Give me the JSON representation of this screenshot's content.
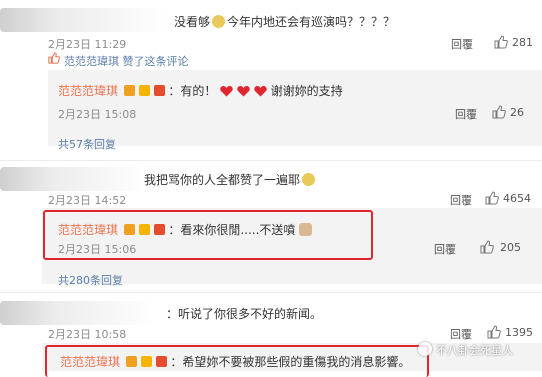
{
  "c1": {
    "text": "没看够",
    "text2": "今年内地还会有巡演吗？？？？",
    "date": "2月23日 11:29",
    "reply": "回覆",
    "likes": "281",
    "liked_by": "范范范瑋琪 赞了这条评论"
  },
  "r1": {
    "user": "范范范瑋琪",
    "text": "：有的！",
    "text2": "谢谢妳的支持",
    "date": "2月23日 15:08",
    "reply": "回覆",
    "likes": "26"
  },
  "c1_more": "共57条回复",
  "c2": {
    "text": "我把骂你的人全都赞了一遍耶",
    "date": "2月23日 14:52",
    "reply": "回覆",
    "likes": "4654"
  },
  "r2": {
    "user": "范范范瑋琪",
    "text": "：看來你很閒.....不送噴",
    "date": "2月23日 15:06",
    "reply": "回覆",
    "likes": "205"
  },
  "c2_more": "共280条回复",
  "c3": {
    "text": "：听说了你很多不好的新闻。",
    "date": "2月23日 10:58",
    "reply": "回覆",
    "likes": "1395"
  },
  "r3": {
    "user": "范范范瑋琪",
    "text": "：希望妳不要被那些假的重傷我的消息影響。"
  },
  "watermark": "不八卦会死星人",
  "colors": {
    "username": "#eb7350",
    "highlight": "#e0262e",
    "link": "#5b7daa",
    "reply_bg": "#f3f3f3"
  }
}
